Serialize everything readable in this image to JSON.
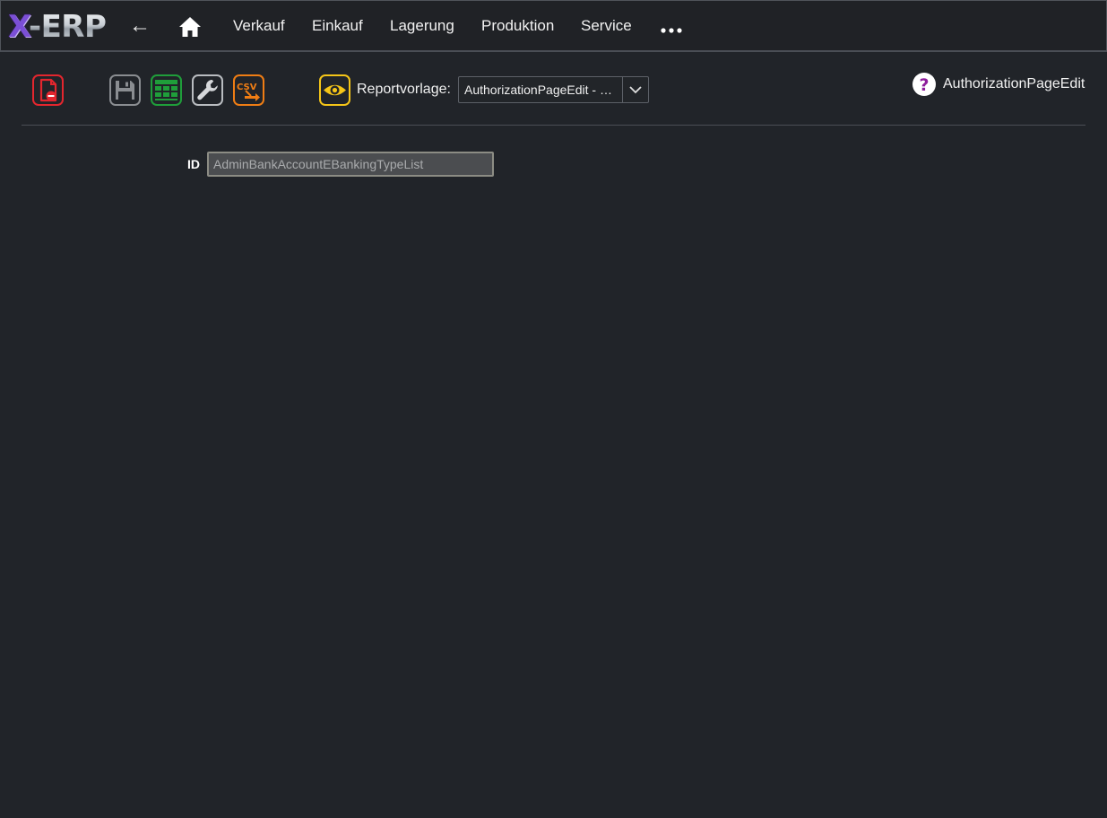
{
  "app": {
    "logo_x": "X",
    "logo_rest": "-ERP"
  },
  "nav": {
    "back_glyph": "←",
    "home_icon": "home-icon",
    "items": [
      {
        "label": "Verkauf"
      },
      {
        "label": "Einkauf"
      },
      {
        "label": "Lagerung"
      },
      {
        "label": "Produktion"
      },
      {
        "label": "Service"
      }
    ],
    "more_icon": "more-dots-icon"
  },
  "toolbar": {
    "delete_icon": "delete-document-icon",
    "save_icon": "save-disk-icon",
    "table_icon": "table-grid-icon",
    "settings_icon": "wrench-icon",
    "csv_label": "CSV",
    "preview_icon": "eye-icon",
    "report_label": "Reportvorlage:",
    "report_value": "AuthorizationPageEdit - …",
    "help_icon": "question-icon",
    "page_name": "AuthorizationPageEdit"
  },
  "form": {
    "id_label": "ID",
    "id_value": "AdminBankAccountEBankingTypeList"
  },
  "colors": {
    "background": "#212429",
    "delete_red": "#e3262e",
    "save_gray": "#8a8d91",
    "table_green": "#1f9e3a",
    "wrench_gray": "#b9bcc0",
    "csv_orange": "#ef7d14",
    "eye_yellow": "#f5c518",
    "help_purple": "#8e1d9c"
  }
}
